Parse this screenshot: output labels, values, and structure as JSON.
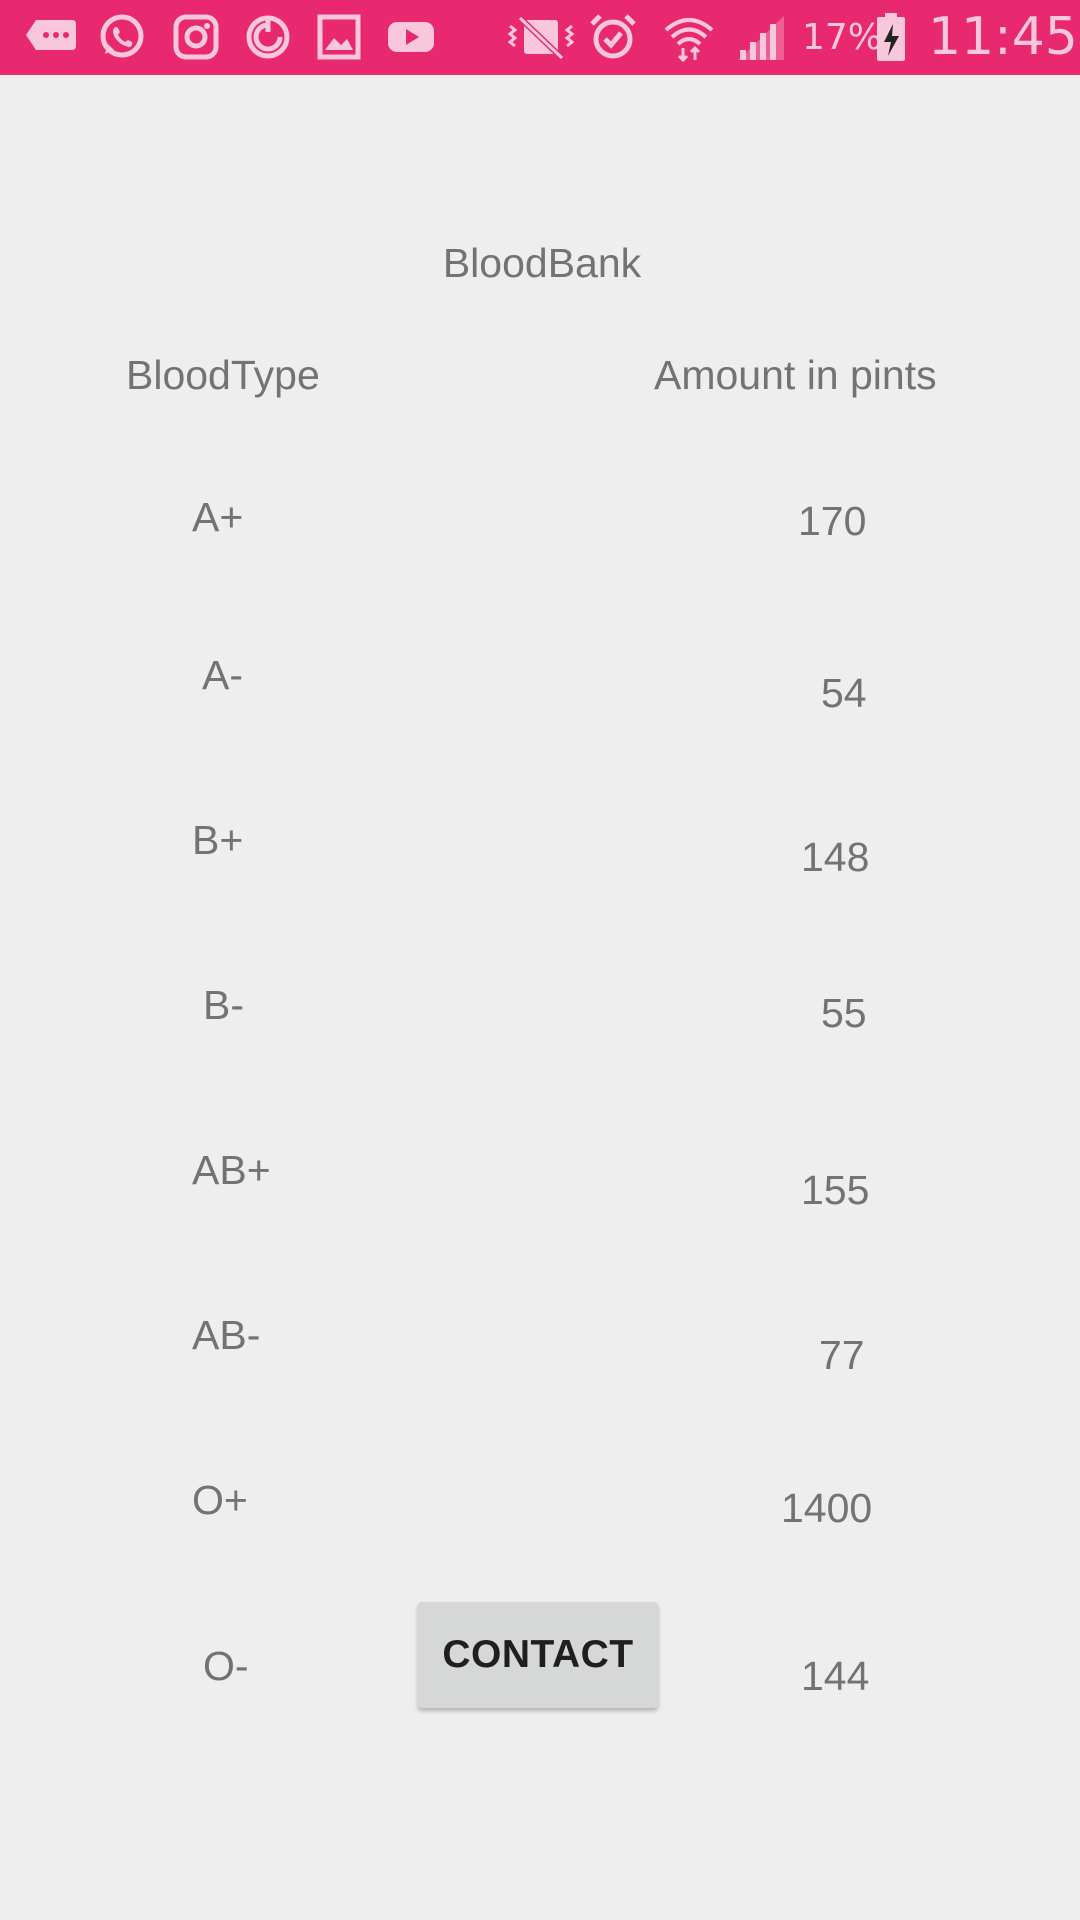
{
  "status_bar": {
    "battery_percent": "17%",
    "time": "11:45",
    "left_icons": [
      "messages-icon",
      "whatsapp-icon",
      "instagram-icon",
      "sync-icon",
      "gallery-icon",
      "youtube-icon"
    ],
    "right_icons": [
      "vibrate-icon",
      "alarm-icon",
      "wifi-icon",
      "signal-icon",
      "battery-charging-icon"
    ],
    "colors": {
      "background": "#e8296f",
      "icon": "#f8c7da"
    }
  },
  "app": {
    "title": "BloodBank"
  },
  "table": {
    "headers": {
      "type": "BloodType",
      "amount": "Amount in pints"
    },
    "rows": [
      {
        "type": "A+",
        "amount": "170"
      },
      {
        "type": "A-",
        "amount": "54"
      },
      {
        "type": "B+",
        "amount": "148"
      },
      {
        "type": "B-",
        "amount": "55"
      },
      {
        "type": "AB+",
        "amount": "155"
      },
      {
        "type": "AB-",
        "amount": "77"
      },
      {
        "type": "O+",
        "amount": "1400"
      },
      {
        "type": "O-",
        "amount": "144"
      }
    ]
  },
  "contact_button": {
    "label": "CONTACT"
  },
  "colors": {
    "background": "#eeeeee",
    "text": "#737373",
    "button": "#d6d7d7"
  }
}
